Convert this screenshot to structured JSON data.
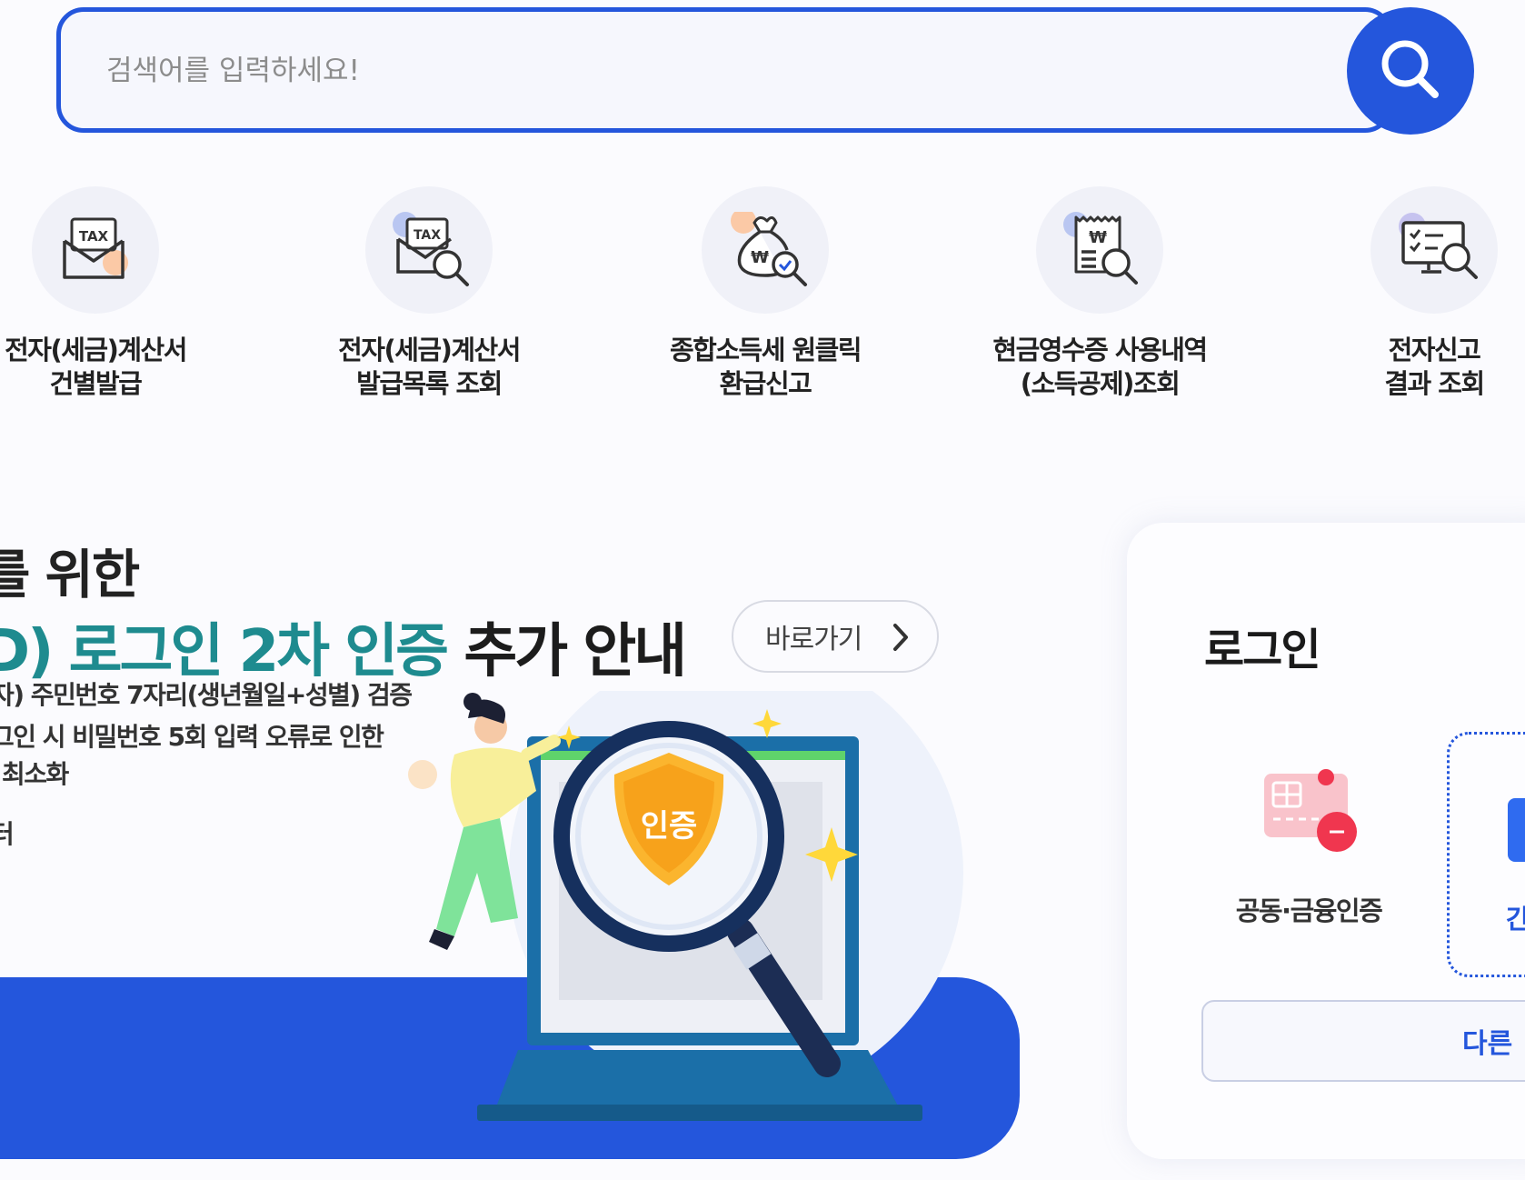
{
  "search": {
    "placeholder": "검색어를 입력하세요!"
  },
  "quick_menu": [
    {
      "label": "전자(세금)계산서\n건별발급",
      "icon": "tax-envelope-icon"
    },
    {
      "label": "전자(세금)계산서\n발급목록 조회",
      "icon": "tax-search-icon"
    },
    {
      "label": "종합소득세 원클릭\n환급신고",
      "icon": "money-bag-search-icon"
    },
    {
      "label": "현금영수증 사용내역\n(소득공제)조회",
      "icon": "receipt-search-icon"
    },
    {
      "label": "전자신고\n결과 조회",
      "icon": "monitor-check-search-icon"
    }
  ],
  "banner": {
    "title_line1": "를 위한",
    "title_line2_highlight": "D) 로그인 2차 인증",
    "title_line2_rest": " 추가 안내",
    "go_label": "바로가기",
    "desc_line1": "자) 주민번호 7자리(생년월일+성별) 검증",
    "desc_line2": "그인 시 비밀번호 5회 입력 오류로 인한",
    "desc_line3": "최소화",
    "desc_line4": "터",
    "badge_text": "인증"
  },
  "login": {
    "title": "로그인",
    "cert_label": "공동·금융인증",
    "simple_label": "간",
    "other_label": "다른"
  },
  "colors": {
    "primary": "#2456dc",
    "teal": "#1e8b8f"
  }
}
